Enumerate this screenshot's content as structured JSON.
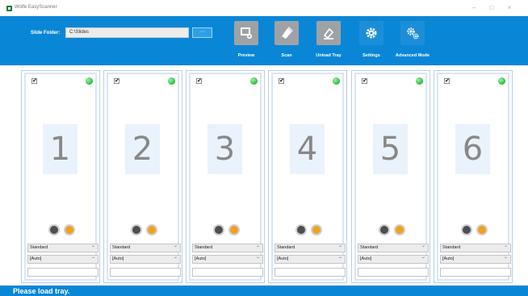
{
  "window": {
    "title": "Wolfe EasyScanner",
    "controls": {
      "minimize": "–",
      "maximize": "□",
      "close": "×"
    }
  },
  "toolbar": {
    "folder_label": "Slide Folder:",
    "folder_value": "C:\\Slides",
    "browse_label": "···",
    "tools": [
      {
        "label": "Preview",
        "icon": "preview-icon"
      },
      {
        "label": "Scan",
        "icon": "scan-icon"
      },
      {
        "label": "Unload Tray",
        "icon": "unload-icon"
      },
      {
        "label": "Settings",
        "icon": "settings-icon"
      },
      {
        "label": "Advanced Mode",
        "icon": "advanced-settings-icon"
      }
    ]
  },
  "slots": [
    {
      "number": "1",
      "checked": "✔",
      "mode": "Standard",
      "option": "[Auto]",
      "name": ""
    },
    {
      "number": "2",
      "checked": "✔",
      "mode": "Standard",
      "option": "[Auto]",
      "name": ""
    },
    {
      "number": "3",
      "checked": "✔",
      "mode": "Standard",
      "option": "[Auto]",
      "name": ""
    },
    {
      "number": "4",
      "checked": "✔",
      "mode": "Standard",
      "option": "[Auto]",
      "name": ""
    },
    {
      "number": "5",
      "checked": "✔",
      "mode": "Standard",
      "option": "[Auto]",
      "name": ""
    },
    {
      "number": "6",
      "checked": "✔",
      "mode": "Standard",
      "option": "[Auto]",
      "name": ""
    }
  ],
  "colors": {
    "toolbar_bg": "#0a86d6",
    "status_bg": "#0a86d6",
    "led_green": "#35c44c",
    "orange_button": "#f0a21e"
  },
  "status": {
    "text": "Please load tray."
  }
}
